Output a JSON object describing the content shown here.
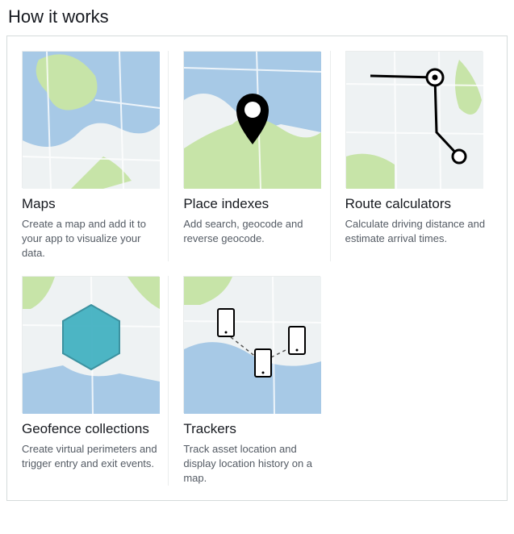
{
  "title": "How it works",
  "cards": [
    {
      "title": "Maps",
      "desc": "Create a map and add it to your app to visualize your data."
    },
    {
      "title": "Place indexes",
      "desc": "Add search, geocode and reverse geocode."
    },
    {
      "title": "Route calculators",
      "desc": "Calculate driving distance and estimate arrival times."
    },
    {
      "title": "Geofence collections",
      "desc": "Create virtual perimeters and trigger entry and exit events."
    },
    {
      "title": "Trackers",
      "desc": "Track asset location and display location history on a map."
    }
  ]
}
